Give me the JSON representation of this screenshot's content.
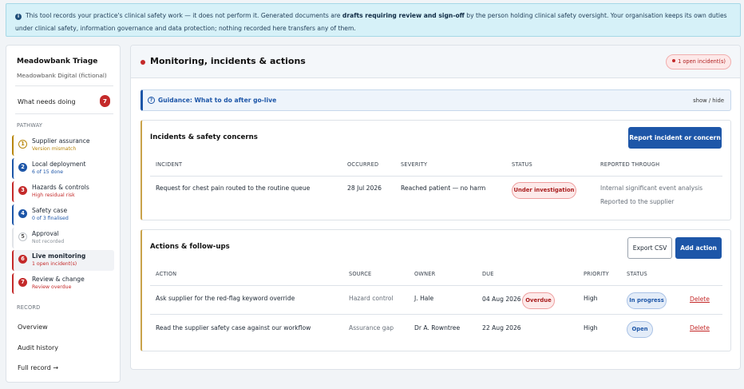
{
  "notice": {
    "text_before": "This tool records your practice's clinical safety work — it does not perform it. Generated documents are ",
    "text_bold": "drafts requiring review and sign-off",
    "text_after": " by the person holding clinical safety oversight. Your organisation keeps its own duties under clinical safety, information governance and data protection; nothing recorded here transfers any of them."
  },
  "sidebar": {
    "app_name": "Meadowbank Triage",
    "app_sub": "Meadowbank Digital (fictional)",
    "what_needs_doing": "What needs doing",
    "what_needs_count": "7",
    "pathway_label": "PATHWAY",
    "steps": [
      {
        "num": "1",
        "title": "Supplier assurance",
        "sub": "Version mismatch",
        "color": "#b8860b"
      },
      {
        "num": "2",
        "title": "Local deployment",
        "sub": "6 of 15 done",
        "color": "#1d56a8"
      },
      {
        "num": "3",
        "title": "Hazards & controls",
        "sub": "High residual risk",
        "color": "#c42a2a"
      },
      {
        "num": "4",
        "title": "Safety case",
        "sub": "0 of 3 finalised",
        "color": "#1d56a8"
      },
      {
        "num": "5",
        "title": "Approval",
        "sub": "Not recorded",
        "color": "#8a9199"
      },
      {
        "num": "6",
        "title": "Live monitoring",
        "sub": "1 open incident(s)",
        "color": "#c42a2a"
      },
      {
        "num": "7",
        "title": "Review & change",
        "sub": "Review overdue",
        "color": "#c42a2a"
      }
    ],
    "record_label": "RECORD",
    "links": [
      "Overview",
      "Audit history",
      "Full record →"
    ]
  },
  "main": {
    "title": "Monitoring, incidents & actions",
    "open_badge": "1 open incident(s)",
    "guidance_title": "Guidance: What to do after go-live",
    "guidance_toggle": "show / hide",
    "incidents": {
      "title": "Incidents & safety concerns",
      "button": "Report incident or concern",
      "headers": [
        "INCIDENT",
        "OCCURRED",
        "SEVERITY",
        "STATUS",
        "REPORTED THROUGH"
      ],
      "rows": [
        {
          "incident": "Request for chest pain routed to the routine queue",
          "occurred": "28 Jul 2026",
          "severity": "Reached patient — no harm",
          "status": "Under investigation",
          "reported_1": "Internal significant event analysis",
          "reported_2": "Reported to the supplier"
        }
      ]
    },
    "actions": {
      "title": "Actions & follow-ups",
      "export_button": "Export CSV",
      "add_button": "Add action",
      "headers": [
        "ACTION",
        "SOURCE",
        "OWNER",
        "DUE",
        "PRIORITY",
        "STATUS"
      ],
      "rows": [
        {
          "action": "Ask supplier for the red-flag keyword override",
          "source": "Hazard control",
          "owner": "J. Hale",
          "due": "04 Aug 2026",
          "overdue": "Overdue",
          "priority": "High",
          "status": "In progress",
          "delete": "Delete"
        },
        {
          "action": "Read the supplier safety case against our workflow",
          "source": "Assurance gap",
          "owner": "Dr A. Rowntree",
          "due": "22 Aug 2026",
          "overdue": "",
          "priority": "High",
          "status": "Open",
          "delete": "Delete"
        }
      ]
    }
  }
}
